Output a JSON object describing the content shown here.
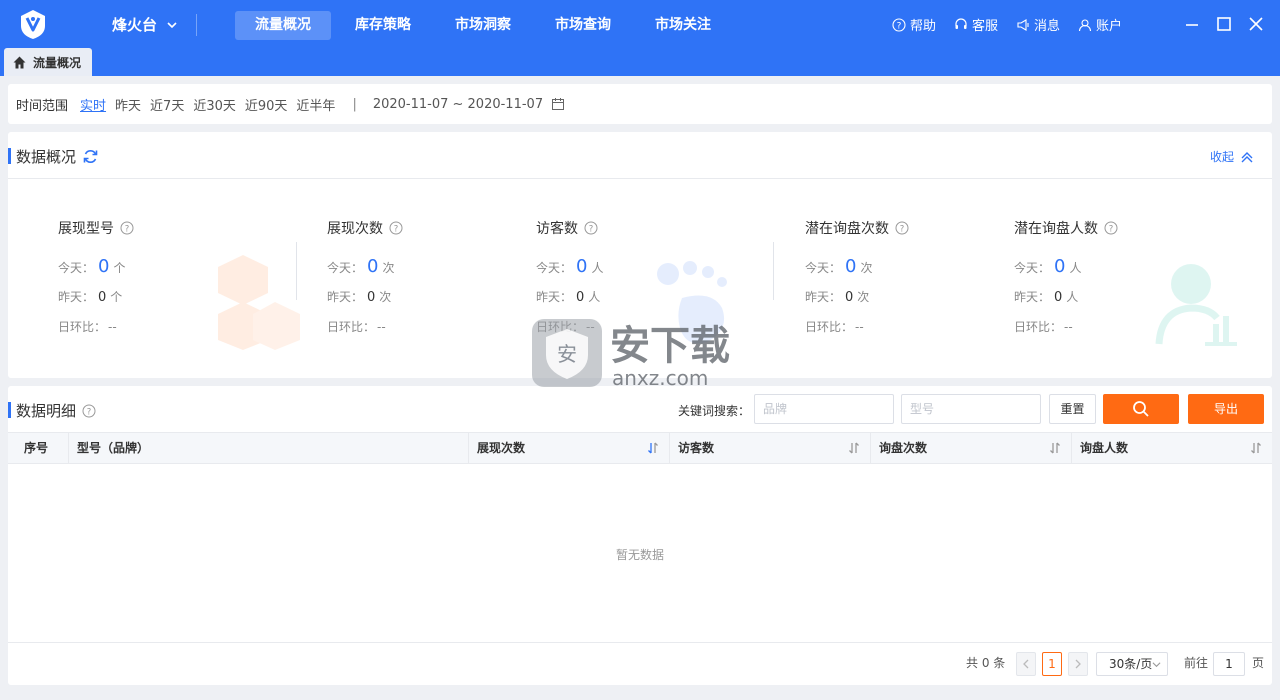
{
  "app": {
    "brand": "烽火台",
    "nav": [
      "流量概况",
      "库存策略",
      "市场洞察",
      "市场查询",
      "市场关注"
    ],
    "active_nav": "流量概况",
    "tools": {
      "help": "帮助",
      "service": "客服",
      "message": "消息",
      "account": "账户"
    }
  },
  "tab": {
    "label": "流量概况"
  },
  "time_range": {
    "label": "时间范围",
    "options": [
      "实时",
      "昨天",
      "近7天",
      "近30天",
      "近90天",
      "近半年"
    ],
    "selected": "实时",
    "separator": "|",
    "date_range": "2020-11-07 ~  2020-11-07"
  },
  "overview": {
    "title": "数据概况",
    "collapse_label": "收起",
    "today_label": "今天：",
    "yesterday_label": "昨天：",
    "ratio_label": "日环比：",
    "metrics": [
      {
        "name": "展现型号",
        "today": "0",
        "yesterday": "0",
        "unit": "个",
        "ratio": "--"
      },
      {
        "name": "展现次数",
        "today": "0",
        "yesterday": "0",
        "unit": "次",
        "ratio": "--"
      },
      {
        "name": "访客数",
        "today": "0",
        "yesterday": "0",
        "unit": "人",
        "ratio": "--"
      },
      {
        "name": "潜在询盘次数",
        "today": "0",
        "yesterday": "0",
        "unit": "次",
        "ratio": "--"
      },
      {
        "name": "潜在询盘人数",
        "today": "0",
        "yesterday": "0",
        "unit": "人",
        "ratio": "--"
      }
    ]
  },
  "watermark": {
    "text": "安下载",
    "sub": "anxz.com"
  },
  "detail": {
    "title": "数据明细",
    "search_label": "关键词搜索：",
    "brand_placeholder": "品牌",
    "model_placeholder": "型号",
    "reset_label": "重置",
    "export_label": "导出",
    "columns": [
      "序号",
      "型号（品牌）",
      "展现次数",
      "访客数",
      "询盘次数",
      "询盘人数"
    ],
    "empty_text": "暂无数据"
  },
  "pagination": {
    "total": "共 0 条",
    "current_page": "1",
    "page_size": "30条/页",
    "goto_label": "前往",
    "goto_value": "1",
    "page_unit": "页"
  },
  "colors": {
    "primary": "#2f73f6",
    "accent": "#ff6a13"
  }
}
